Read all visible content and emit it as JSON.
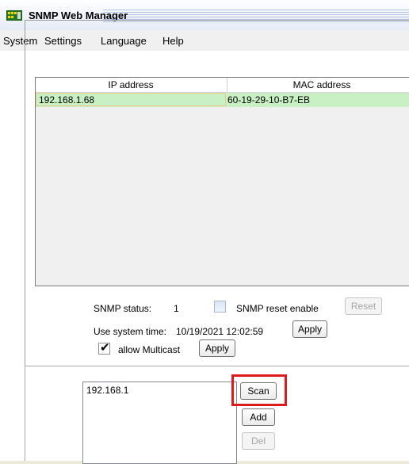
{
  "window": {
    "title": "SNMP Web Manager"
  },
  "menu": {
    "items": [
      "System",
      "Settings",
      "Language",
      "Help"
    ]
  },
  "table": {
    "columns": [
      "IP address",
      "MAC address"
    ],
    "rows": [
      {
        "ip": "192.168.1.68",
        "mac": "60-19-29-10-B7-EB"
      }
    ]
  },
  "status": {
    "snmp_status_label": "SNMP status:",
    "snmp_status_value": "1",
    "reset_enable_label": "SNMP reset enable",
    "reset_label": "Reset",
    "system_time_label": "Use system time:",
    "system_time_value": "10/19/2021 12:02:59",
    "apply_label": "Apply",
    "multicast_label": "allow Multicast",
    "multicast_apply_label": "Apply"
  },
  "scan": {
    "ip_items": [
      "192.168.1"
    ],
    "scan_label": "Scan",
    "add_label": "Add",
    "del_label": "Del"
  },
  "colors": {
    "selected_row": "#c8f0c4",
    "highlight": "#e01a1a"
  }
}
